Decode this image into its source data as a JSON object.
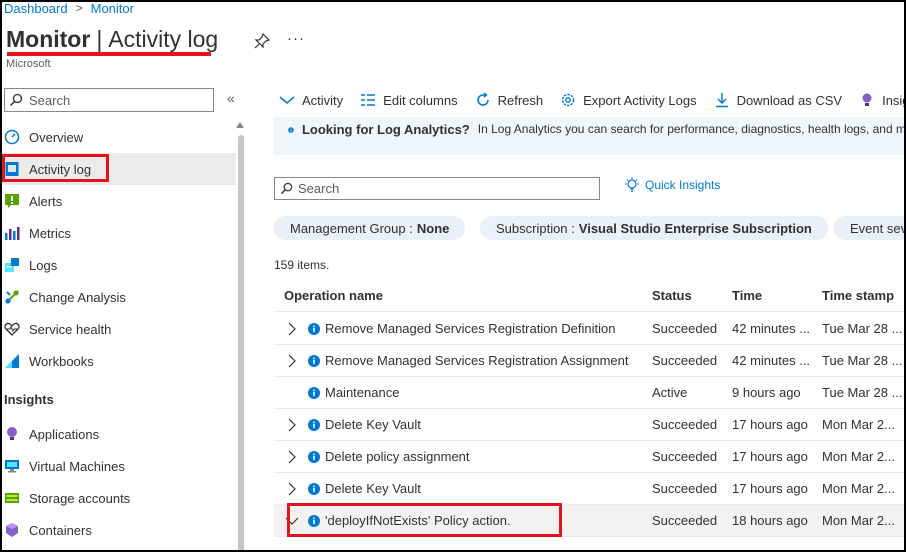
{
  "breadcrumb": {
    "items": [
      "Dashboard",
      "Monitor"
    ],
    "separator": ">"
  },
  "header": {
    "title_main": "Monitor",
    "title_sep": "|",
    "title_sub": "Activity log",
    "subtitle": "Microsoft",
    "more": "···"
  },
  "sidebar": {
    "search_placeholder": "Search",
    "collapse": "«",
    "items": [
      {
        "label": "Overview",
        "icon": "gauge-icon"
      },
      {
        "label": "Activity log",
        "icon": "activity-log-icon"
      },
      {
        "label": "Alerts",
        "icon": "alerts-icon"
      },
      {
        "label": "Metrics",
        "icon": "metrics-icon"
      },
      {
        "label": "Logs",
        "icon": "logs-icon"
      },
      {
        "label": "Change Analysis",
        "icon": "change-analysis-icon"
      },
      {
        "label": "Service health",
        "icon": "heart-icon"
      },
      {
        "label": "Workbooks",
        "icon": "workbooks-icon"
      }
    ],
    "section_insights": "Insights",
    "insights": [
      {
        "label": "Applications",
        "icon": "lightbulb-icon"
      },
      {
        "label": "Virtual Machines",
        "icon": "vm-icon"
      },
      {
        "label": "Storage accounts",
        "icon": "storage-icon"
      },
      {
        "label": "Containers",
        "icon": "containers-icon"
      }
    ]
  },
  "toolbar": {
    "activity": "Activity",
    "edit_columns": "Edit columns",
    "refresh": "Refresh",
    "export": "Export Activity Logs",
    "download": "Download as CSV",
    "insights": "Insigh"
  },
  "info": {
    "title": "Looking for Log Analytics?",
    "message": "In Log Analytics you can search for performance, diagnostics, health logs, and m"
  },
  "main": {
    "search_placeholder": "Search",
    "quick_insights": "Quick Insights",
    "filters": [
      {
        "label": "Management Group :",
        "value": "None"
      },
      {
        "label": "Subscription :",
        "value": "Visual Studio Enterprise Subscription"
      },
      {
        "label": "Event seve",
        "value": ""
      }
    ],
    "count": "159 items."
  },
  "table": {
    "columns": [
      "Operation name",
      "Status",
      "Time",
      "Time stamp"
    ],
    "rows": [
      {
        "op": "Remove Managed Services Registration Definition",
        "status": "Succeeded",
        "time": "42 minutes ...",
        "ts": "Tue Mar 28 ..."
      },
      {
        "op": "Remove Managed Services Registration Assignment",
        "status": "Succeeded",
        "time": "42 minutes ...",
        "ts": "Tue Mar 28 ..."
      },
      {
        "op": "Maintenance",
        "status": "Active",
        "time": "9 hours ago",
        "ts": "Tue Mar 28 ..."
      },
      {
        "op": "Delete Key Vault",
        "status": "Succeeded",
        "time": "17 hours ago",
        "ts": "Mon Mar 2..."
      },
      {
        "op": "Delete policy assignment",
        "status": "Succeeded",
        "time": "17 hours ago",
        "ts": "Mon Mar 2..."
      },
      {
        "op": "Delete Key Vault",
        "status": "Succeeded",
        "time": "17 hours ago",
        "ts": "Mon Mar 2..."
      },
      {
        "op": "'deployIfNotExists' Policy action.",
        "status": "Succeeded",
        "time": "18 hours ago",
        "ts": "Mon Mar 2..."
      }
    ]
  },
  "colors": {
    "accent": "#0078d4",
    "highlight": "#e3141d",
    "info_bg": "#eff6fc",
    "pill_bg": "#eaf0f7"
  }
}
